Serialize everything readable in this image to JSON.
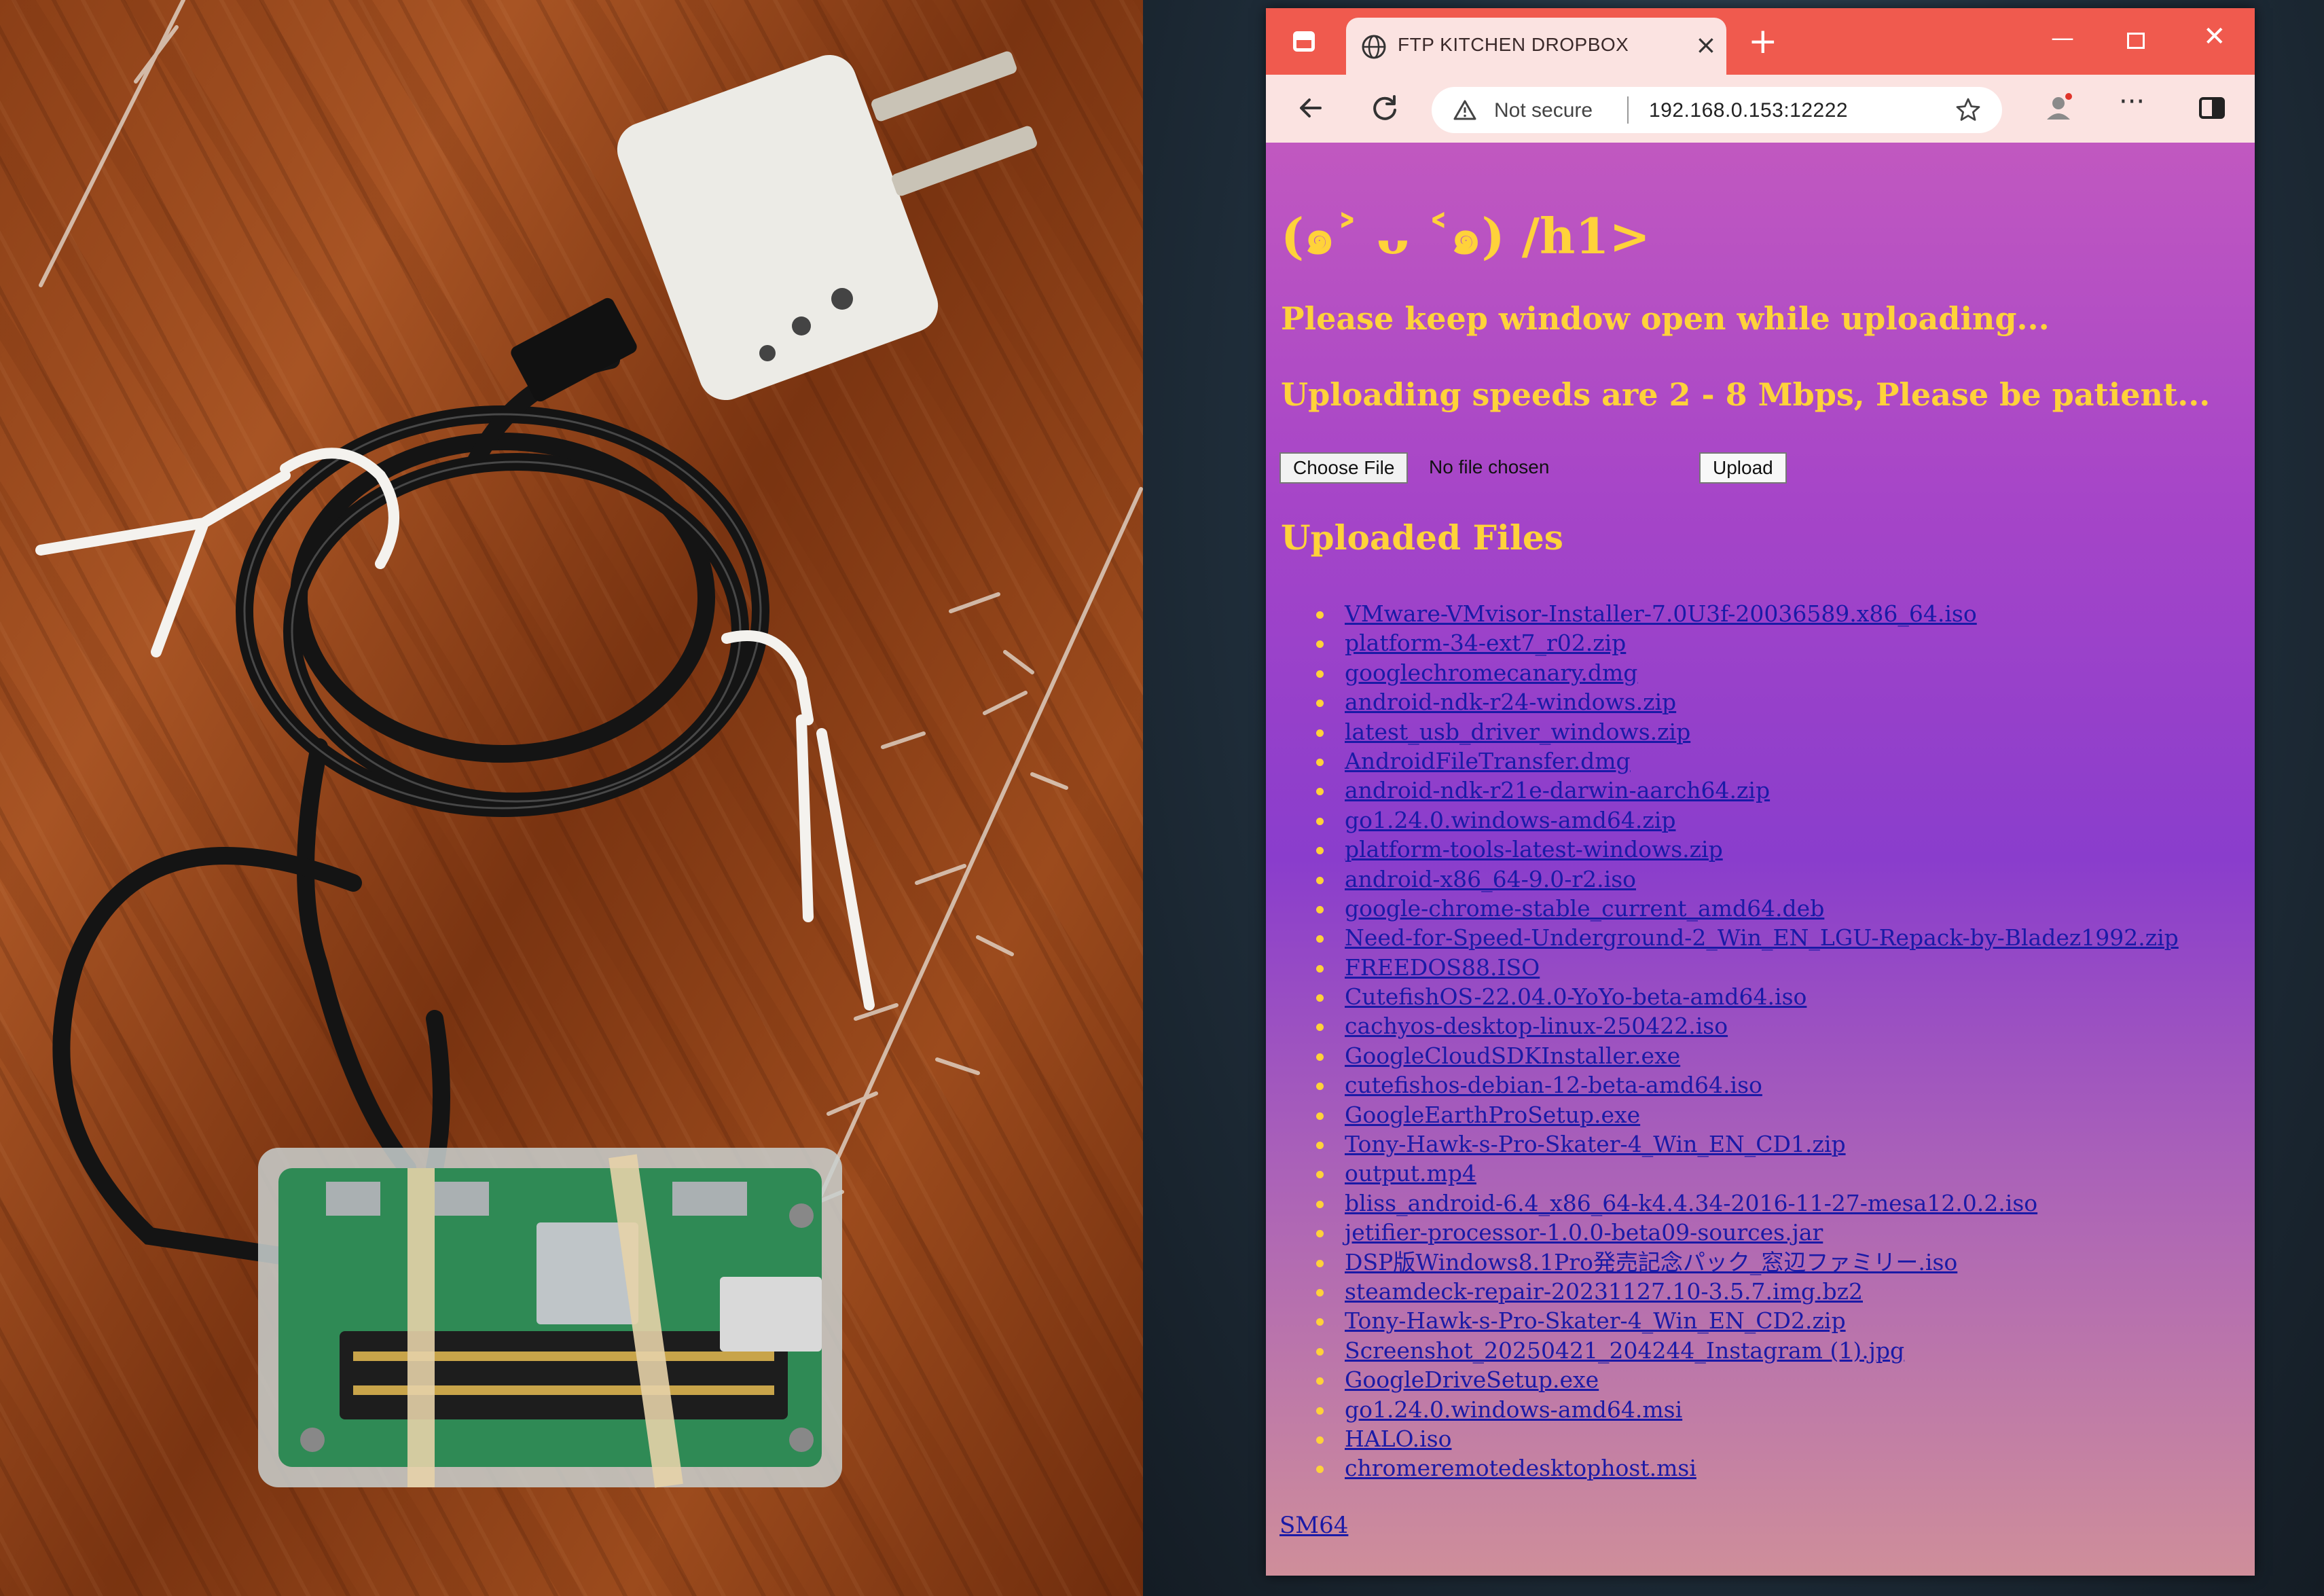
{
  "browser": {
    "tab_title": "FTP KITCHEN DROPBOX",
    "tab_close": "×",
    "new_tab": "+",
    "window_minimize": "—",
    "window_close": "✕",
    "security_label": "Not secure",
    "url": "192.168.0.153:12222",
    "more_label": "···"
  },
  "page": {
    "heading": "(๑˃ ᴗ ˂๑) /h1>",
    "notice_1": "Please keep window open while uploading...",
    "notice_2": "Uploading speeds are 2 - 8 Mbps, Please be patient...",
    "choose_file_label": "Choose File",
    "no_file_text": "No file chosen",
    "upload_label": "Upload",
    "files_heading": "Uploaded Files",
    "files": [
      "VMware-VMvisor-Installer-7.0U3f-20036589.x86_64.iso",
      "platform-34-ext7_r02.zip",
      "googlechromecanary.dmg",
      "android-ndk-r24-windows.zip",
      "latest_usb_driver_windows.zip",
      "AndroidFileTransfer.dmg",
      "android-ndk-r21e-darwin-aarch64.zip",
      "go1.24.0.windows-amd64.zip",
      "platform-tools-latest-windows.zip",
      "android-x86_64-9.0-r2.iso",
      "google-chrome-stable_current_amd64.deb",
      "Need-for-Speed-Underground-2_Win_EN_LGU-Repack-by-Bladez1992.zip",
      "FREEDOS88.ISO",
      "CutefishOS-22.04.0-YoYo-beta-amd64.iso",
      "cachyos-desktop-linux-250422.iso",
      "GoogleCloudSDKInstaller.exe",
      "cutefishos-debian-12-beta-amd64.iso",
      "GoogleEarthProSetup.exe",
      "Tony-Hawk-s-Pro-Skater-4_Win_EN_CD1.zip",
      "output.mp4",
      "bliss_android-6.4_x86_64-k4.4.34-2016-11-27-mesa12.0.2.iso",
      "jetifier-processor-1.0.0-beta09-sources.jar",
      "DSP版Windows8.1Pro発売記念パック_窓辺ファミリー.iso",
      "steamdeck-repair-20231127.10-3.5.7.img.bz2",
      "Tony-Hawk-s-Pro-Skater-4_Win_EN_CD2.zip",
      "Screenshot_20250421_204244_Instagram (1).jpg",
      "GoogleDriveSetup.exe",
      "go1.24.0.windows-amd64.msi",
      "HALO.iso",
      "chromeremotedesktophost.msi"
    ],
    "footer_link": "SM64"
  },
  "colors": {
    "accent_yellow": "#ffd23a",
    "link_blue": "#1a1aa6",
    "titlebar_red": "#f05a4e",
    "toolbar_pink": "#fbe3e1"
  },
  "icons": {
    "tab_actions": "tab-actions-icon",
    "tab_favicon": "globe-icon",
    "back": "back-arrow-icon",
    "refresh": "refresh-icon",
    "warning": "warning-icon",
    "favorite": "star-icon",
    "profile": "profile-icon",
    "more": "more-icon",
    "sidebar": "sidebar-icon"
  }
}
